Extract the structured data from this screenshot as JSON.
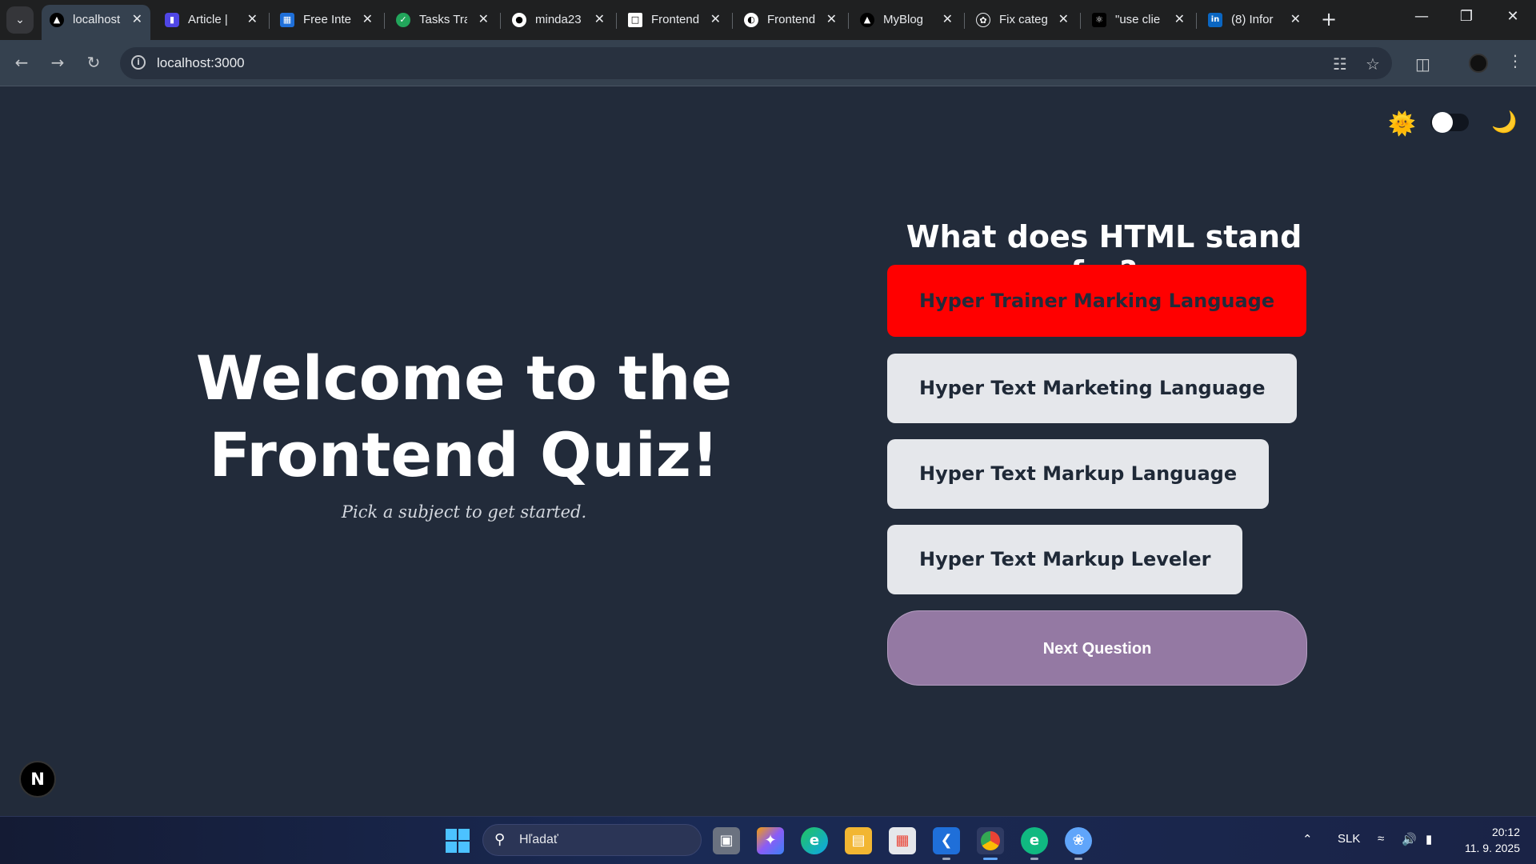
{
  "browser": {
    "tabs": [
      {
        "title": "localhost",
        "favicon": "nextjs-icon",
        "active": true
      },
      {
        "title": "Article | ",
        "favicon": "article-icon"
      },
      {
        "title": "Free Inte",
        "favicon": "interview-icon"
      },
      {
        "title": "Tasks Tra",
        "favicon": "tasks-check-icon"
      },
      {
        "title": "minda23",
        "favicon": "github-icon"
      },
      {
        "title": "Frontend",
        "favicon": "frontend-icon"
      },
      {
        "title": "Frontend",
        "favicon": "frontend-circle-icon"
      },
      {
        "title": "MyBlog",
        "favicon": "vercel-icon"
      },
      {
        "title": "Fix categ",
        "favicon": "openai-icon"
      },
      {
        "title": "\"use clie",
        "favicon": "react-icon"
      },
      {
        "title": "(8) Infor",
        "favicon": "linkedin-icon"
      }
    ],
    "url": "localhost:3000"
  },
  "page": {
    "welcome_title": "Welcome to the Frontend Quiz!",
    "subtitle": "Pick a subject to get started.",
    "question": "What does HTML stand for?",
    "answers": [
      {
        "label": "Hyper Trainer Marking Language",
        "state": "wrong"
      },
      {
        "label": "Hyper Text Marketing Language",
        "state": "default"
      },
      {
        "label": "Hyper Text Markup Language",
        "state": "default"
      },
      {
        "label": "Hyper Text Markup Leveler",
        "state": "default"
      }
    ],
    "next_button": "Next Question",
    "theme_toggle": {
      "left_icon": "sun-icon",
      "right_icon": "moon-icon",
      "mode": "light"
    },
    "dev_badge": "N"
  },
  "taskbar": {
    "search_placeholder": "Hľadať",
    "language": "SLK",
    "time": "20:12",
    "date": "11. 9. 2025"
  },
  "colors": {
    "page_bg": "#222b3a",
    "wrong_answer": "#ff0000",
    "answer_bg": "#e5e7eb",
    "next_button": "#9479a3"
  }
}
